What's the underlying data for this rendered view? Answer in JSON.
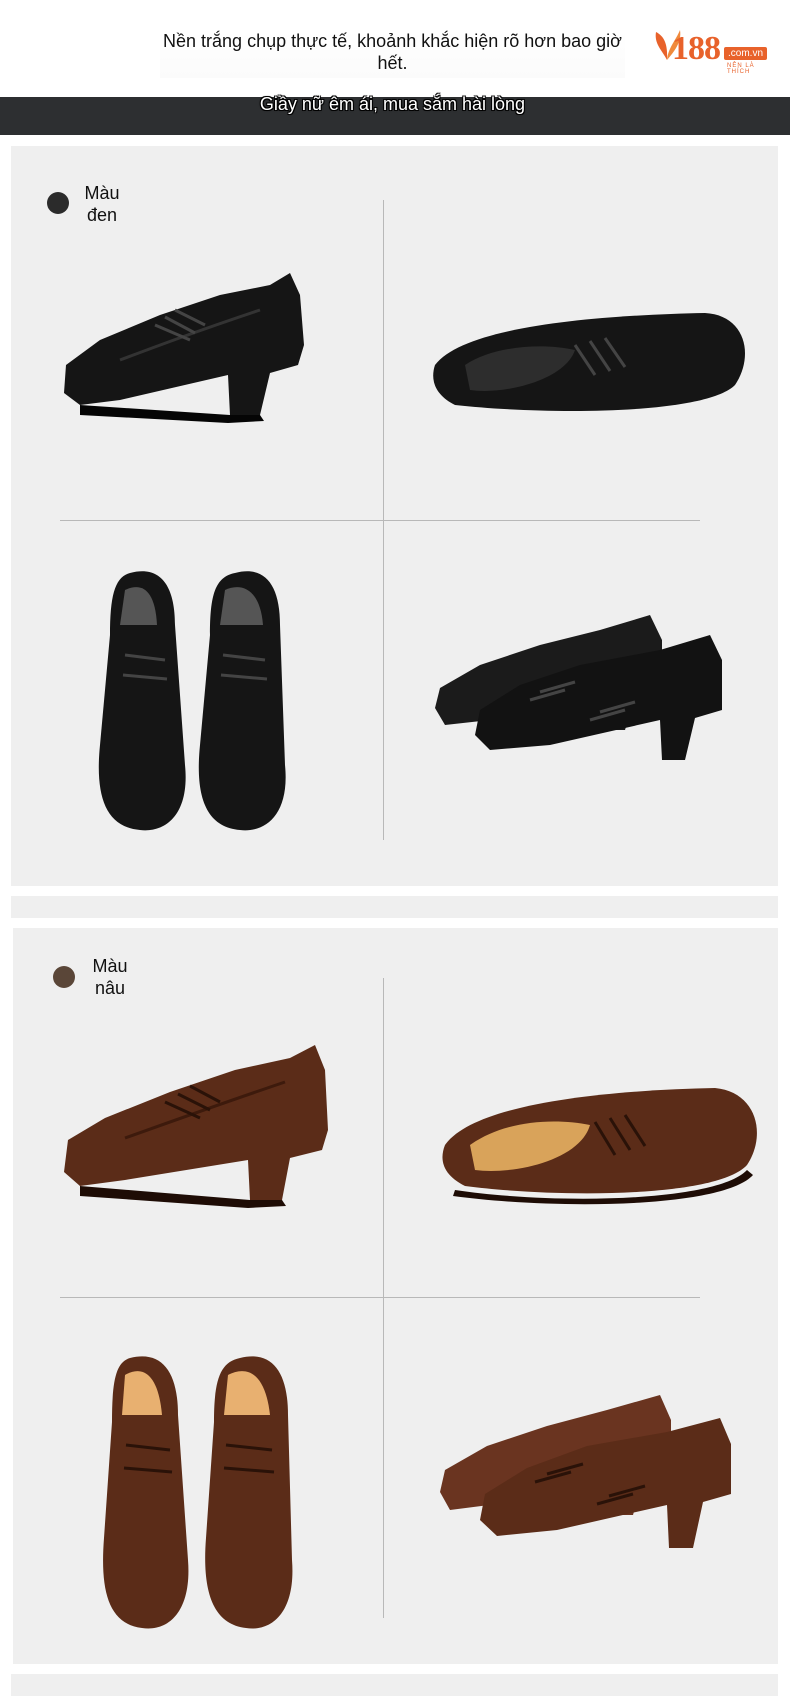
{
  "header": {
    "caption": "Nền trắng chụp thực tế, khoảnh khắc hiện rõ hơn bao giờ hết.",
    "logo": {
      "number": "188",
      "domain": ".com.vn",
      "tagline": "NÊN LÀ THÍCH",
      "brand_color": "#e8622b"
    }
  },
  "banner": {
    "text": "Giầy nữ êm ái, mua sắm hài lòng",
    "background": "#2d2f31"
  },
  "variants": [
    {
      "label": "Màu đen",
      "swatch_color": "#2b2b2b",
      "leather_color": "#151515",
      "icon": "black-shoe"
    },
    {
      "label": "Màu nâu",
      "swatch_color": "#5a4638",
      "leather_color": "#5b2c18",
      "icon": "brown-shoe"
    }
  ]
}
